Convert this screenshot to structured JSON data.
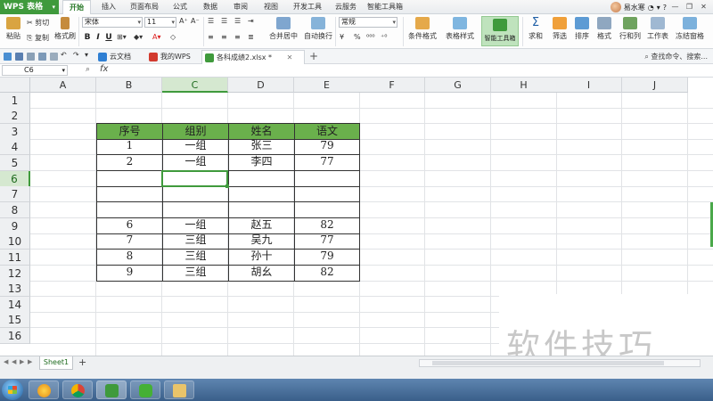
{
  "app": {
    "name": "WPS 表格",
    "user": "易水寒"
  },
  "menu_tabs": [
    "开始",
    "插入",
    "页面布局",
    "公式",
    "数据",
    "审阅",
    "视图",
    "开发工具",
    "云服务",
    "智能工具箱"
  ],
  "ribbon": {
    "paste": "粘贴",
    "cut": "剪切",
    "copy": "复制",
    "format_painter": "格式刷",
    "font_name": "宋体",
    "font_size": "11",
    "bold": "B",
    "italic": "I",
    "underline": "U",
    "merge_center": "合并居中",
    "wrap_text": "自动换行",
    "number_format": "常规",
    "currency": "¥",
    "percent": "%",
    "cond_format": "条件格式",
    "table_style": "表格样式",
    "smart_toolbox": "智能工具箱",
    "sum": "求和",
    "filter": "筛选",
    "sort": "排序",
    "format": "格式",
    "rows_cols": "行和列",
    "worksheet": "工作表",
    "freeze_panes": "冻结窗格"
  },
  "doc_tabs": [
    {
      "label": "云文档"
    },
    {
      "label": "我的WPS"
    },
    {
      "label": "各科成绩2.xlsx *"
    }
  ],
  "find_command": "查找命令、搜索...",
  "formula_bar": {
    "name_box": "C6",
    "fx": "fx",
    "content": ""
  },
  "columns": [
    "A",
    "B",
    "C",
    "D",
    "E",
    "F",
    "G",
    "H",
    "I",
    "J"
  ],
  "rows": [
    "1",
    "2",
    "3",
    "4",
    "5",
    "6",
    "7",
    "8",
    "9",
    "10",
    "11",
    "12",
    "13",
    "14",
    "15",
    "16"
  ],
  "table": {
    "headers": [
      "序号",
      "组别",
      "姓名",
      "语文"
    ],
    "rows": [
      [
        "1",
        "一组",
        "张三",
        "79"
      ],
      [
        "2",
        "一组",
        "李四",
        "77"
      ],
      [
        "",
        "",
        "",
        ""
      ],
      [
        "",
        "",
        "",
        ""
      ],
      [
        "",
        "",
        "",
        ""
      ],
      [
        "6",
        "一组",
        "赵五",
        "82"
      ],
      [
        "7",
        "三组",
        "吴九",
        "77"
      ],
      [
        "8",
        "三组",
        "孙十",
        "79"
      ],
      [
        "9",
        "三组",
        "胡幺",
        "82"
      ]
    ]
  },
  "sheet_tabs": [
    "Sheet1"
  ],
  "watermark": "软件技巧",
  "colors": {
    "accent": "#3f9a3c",
    "header_fill": "#6ab04c",
    "selection": "#d5e8d0"
  }
}
